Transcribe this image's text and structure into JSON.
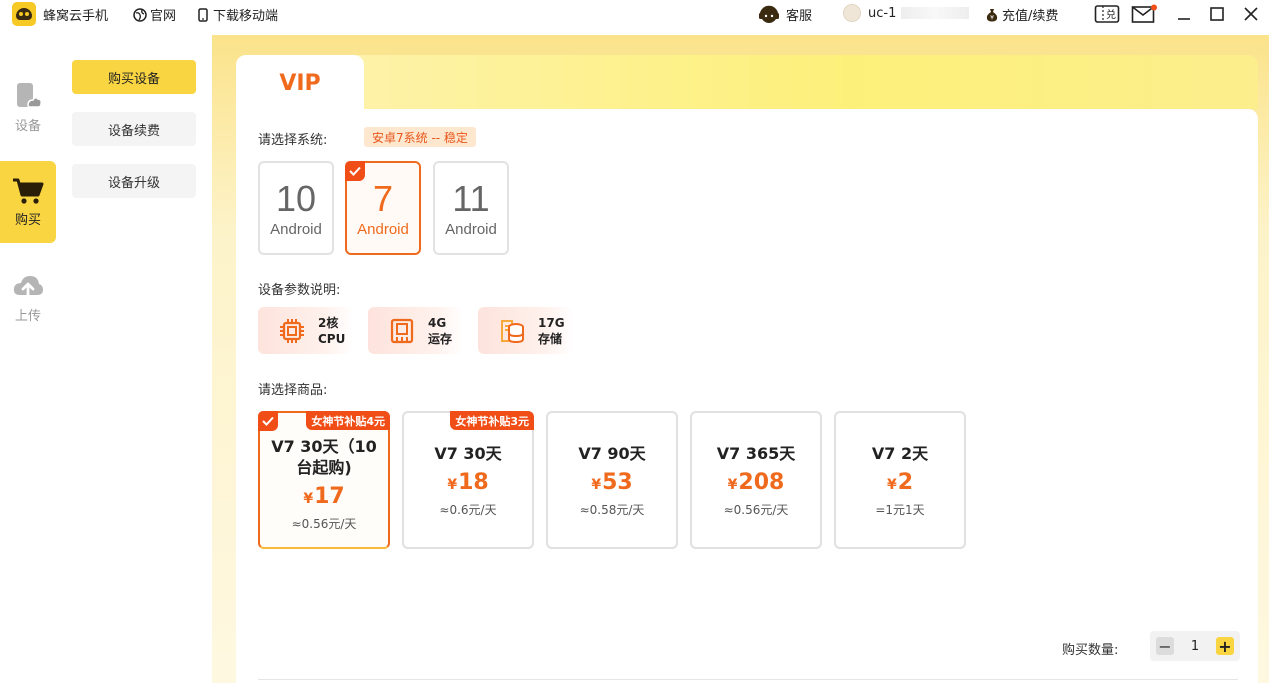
{
  "titlebar": {
    "app_title": "蜂窝云手机",
    "official_site": "官网",
    "download_mobile": "下载移动端",
    "customer_service": "客服",
    "username": "uc-1",
    "recharge": "充值/续费"
  },
  "leftnav": {
    "items": [
      {
        "label": "设备",
        "icon": "phone-cloud-icon"
      },
      {
        "label": "购买",
        "icon": "cart-icon"
      },
      {
        "label": "上传",
        "icon": "cloud-upload-icon"
      }
    ]
  },
  "submenu": {
    "items": [
      "购买设备",
      "设备续费",
      "设备升级"
    ]
  },
  "main": {
    "tab": "VIP",
    "system_label": "请选择系统:",
    "system_tag": "安卓7系统 -- 稳定",
    "os_options": [
      {
        "num": "10",
        "name": "Android"
      },
      {
        "num": "7",
        "name": "Android"
      },
      {
        "num": "11",
        "name": "Android"
      }
    ],
    "params_label": "设备参数说明:",
    "params": [
      {
        "value": "2核",
        "unit": "CPU"
      },
      {
        "value": "4G",
        "unit": "运存"
      },
      {
        "value": "17G",
        "unit": "存储"
      }
    ],
    "goods_label": "请选择商品:",
    "goods": [
      {
        "badge": "女神节补贴4元",
        "name": "V7 30天（10台起购)",
        "price": "17",
        "per": "≈0.56元/天"
      },
      {
        "badge": "女神节补贴3元",
        "name": "V7 30天",
        "price": "18",
        "per": "≈0.6元/天"
      },
      {
        "badge": "",
        "name": "V7 90天",
        "price": "53",
        "per": "≈0.58元/天"
      },
      {
        "badge": "",
        "name": "V7 365天",
        "price": "208",
        "per": "≈0.56元/天"
      },
      {
        "badge": "",
        "name": "V7 2天",
        "price": "2",
        "per": "=1元1天"
      }
    ],
    "currency": "¥",
    "quantity_label": "购买数量:",
    "quantity": "1",
    "minus": "−",
    "plus": "+"
  },
  "colors": {
    "accent_yellow": "#f9d542",
    "accent_orange": "#f06a1d",
    "badge_red": "#f04e16"
  }
}
